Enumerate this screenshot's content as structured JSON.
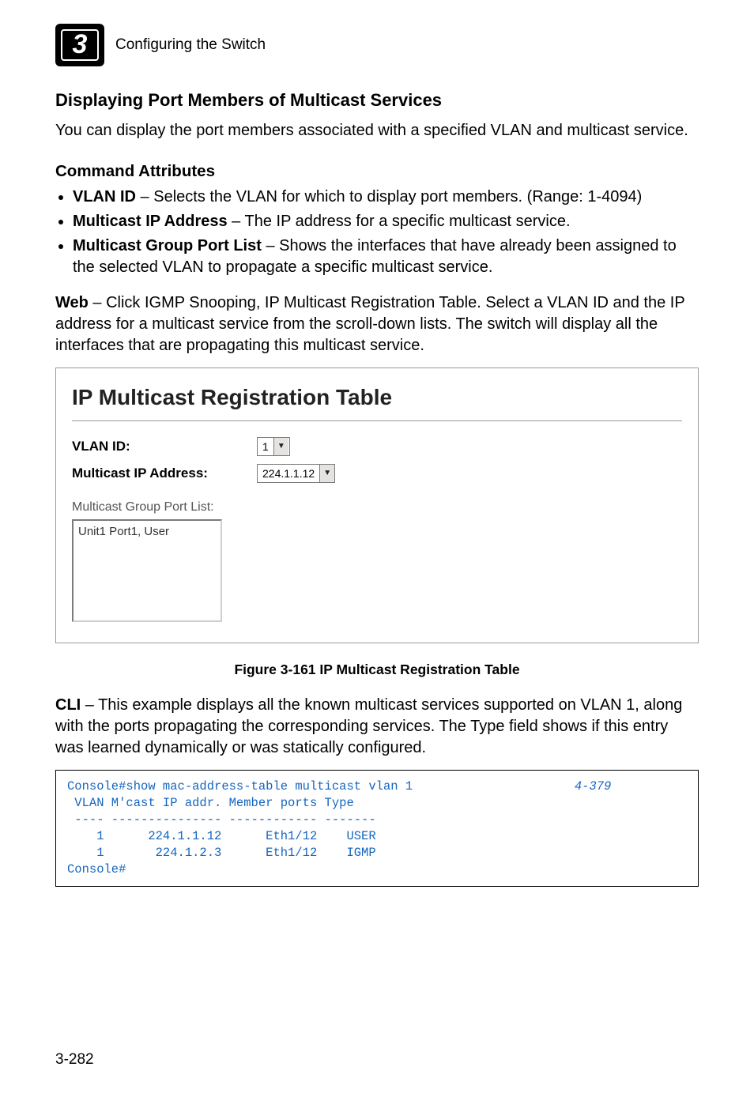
{
  "runhead": {
    "chapter_number": "3",
    "title": "Configuring the Switch"
  },
  "section": {
    "title": "Displaying Port Members of Multicast Services",
    "intro": "You can display the port members associated with a specified VLAN and multicast service.",
    "cmd_attr_heading": "Command Attributes",
    "bullets": [
      {
        "term": "VLAN ID",
        "desc": " – Selects the VLAN for which to display port members. (Range: 1-4094)"
      },
      {
        "term": "Multicast IP Address",
        "desc": " – The IP address for a specific multicast service."
      },
      {
        "term": "Multicast Group Port List",
        "desc": " – Shows the interfaces that have already been assigned to the selected VLAN to propagate a specific multicast service."
      }
    ],
    "web_prefix": "Web",
    "web_text": " – Click IGMP Snooping, IP Multicast Registration Table. Select a VLAN ID and the IP address for a multicast service from the scroll-down lists. The switch will display all the interfaces that are propagating this multicast service."
  },
  "screenshot": {
    "title": "IP Multicast Registration Table",
    "vlan_label": "VLAN ID:",
    "vlan_value": "1",
    "mip_label": "Multicast IP Address:",
    "mip_value": "224.1.1.12",
    "grouplist_caption": "Multicast Group Port List:",
    "grouplist_item": "Unit1 Port1, User"
  },
  "figure_caption": "Figure 3-161  IP Multicast Registration Table",
  "cli": {
    "prefix": "CLI",
    "text": " – This example displays all the known multicast services supported on VLAN 1, along with the ports propagating the corresponding services. The Type field shows if this entry was learned dynamically or was statically configured.",
    "page_ref": "4-379",
    "lines": [
      "Console#show mac-address-table multicast vlan 1",
      " VLAN M'cast IP addr. Member ports Type",
      " ---- --------------- ------------ -------",
      "    1      224.1.1.12      Eth1/12    USER",
      "    1       224.1.2.3      Eth1/12    IGMP",
      "Console#"
    ]
  },
  "folio": "3-282",
  "chart_data": {
    "type": "table",
    "title": "show mac-address-table multicast vlan 1",
    "columns": [
      "VLAN",
      "M'cast IP addr.",
      "Member ports",
      "Type"
    ],
    "rows": [
      [
        1,
        "224.1.1.12",
        "Eth1/12",
        "USER"
      ],
      [
        1,
        "224.1.2.3",
        "Eth1/12",
        "IGMP"
      ]
    ]
  }
}
